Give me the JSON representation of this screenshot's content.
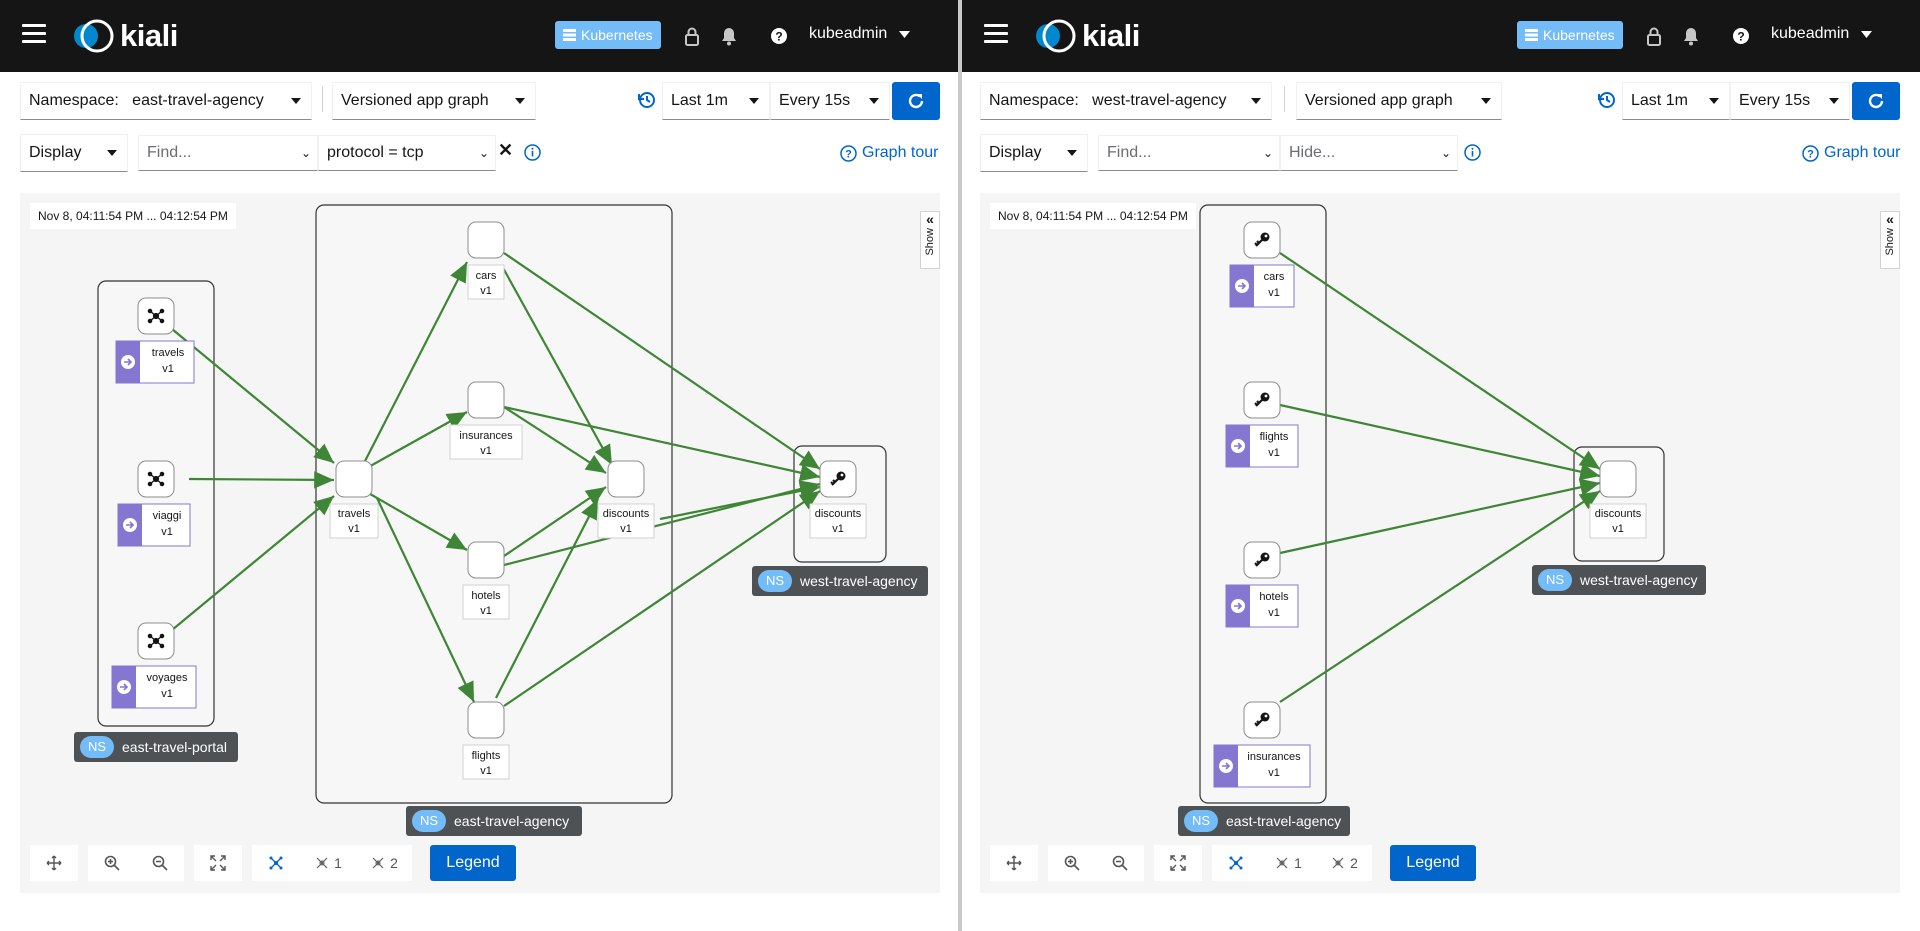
{
  "masthead": {
    "logo_text": "kiali",
    "cluster_badge": "Kubernetes",
    "user": "kubeadmin"
  },
  "panels": [
    {
      "namespace_label": "Namespace:",
      "namespace_value": "east-travel-agency",
      "graph_type": "Versioned app graph",
      "duration": "Last 1m",
      "refresh": "Every 15s",
      "display": "Display",
      "find_placeholder": "Find...",
      "filter_value": "protocol = tcp",
      "graph_tour": "Graph tour",
      "timestamp": "Nov 8, 04:11:54 PM ... 04:12:54 PM",
      "show_tab": "Show",
      "legend": "Legend",
      "namespace_boxes": [
        "east-travel-portal",
        "east-travel-agency",
        "west-travel-agency"
      ],
      "ns_badge": "NS",
      "nodes": [
        {
          "name": "travels",
          "version": "v1",
          "group": "east-travel-portal",
          "kind": "app"
        },
        {
          "name": "viaggi",
          "version": "v1",
          "group": "east-travel-portal",
          "kind": "app"
        },
        {
          "name": "voyages",
          "version": "v1",
          "group": "east-travel-portal",
          "kind": "app"
        },
        {
          "name": "travels",
          "version": "v1",
          "group": "east-travel-agency",
          "kind": "app"
        },
        {
          "name": "cars",
          "version": "v1",
          "group": "east-travel-agency",
          "kind": "app"
        },
        {
          "name": "insurances",
          "version": "v1",
          "group": "east-travel-agency",
          "kind": "app"
        },
        {
          "name": "hotels",
          "version": "v1",
          "group": "east-travel-agency",
          "kind": "app"
        },
        {
          "name": "flights",
          "version": "v1",
          "group": "east-travel-agency",
          "kind": "app"
        },
        {
          "name": "discounts",
          "version": "v1",
          "group": "east-travel-agency",
          "kind": "app"
        },
        {
          "name": "discounts",
          "version": "v1",
          "group": "west-travel-agency",
          "kind": "app"
        }
      ],
      "toolbar_counts": [
        "1",
        "2"
      ]
    },
    {
      "namespace_label": "Namespace:",
      "namespace_value": "west-travel-agency",
      "graph_type": "Versioned app graph",
      "duration": "Last 1m",
      "refresh": "Every 15s",
      "display": "Display",
      "find_placeholder": "Find...",
      "hide_placeholder": "Hide...",
      "graph_tour": "Graph tour",
      "timestamp": "Nov 8, 04:11:54 PM ... 04:12:54 PM",
      "show_tab": "Show",
      "legend": "Legend",
      "namespace_boxes": [
        "east-travel-agency",
        "west-travel-agency"
      ],
      "ns_badge": "NS",
      "nodes": [
        {
          "name": "cars",
          "version": "v1",
          "group": "east-travel-agency",
          "kind": "service-entry"
        },
        {
          "name": "flights",
          "version": "v1",
          "group": "east-travel-agency",
          "kind": "service-entry"
        },
        {
          "name": "hotels",
          "version": "v1",
          "group": "east-travel-agency",
          "kind": "service-entry"
        },
        {
          "name": "insurances",
          "version": "v1",
          "group": "east-travel-agency",
          "kind": "service-entry"
        },
        {
          "name": "discounts",
          "version": "v1",
          "group": "west-travel-agency",
          "kind": "app"
        }
      ],
      "toolbar_counts": [
        "1",
        "2"
      ]
    }
  ],
  "colors": {
    "masthead": "#151515",
    "edge": "#3e8635",
    "app_badge": "#8476d1",
    "primary": "#06c",
    "ns_badge": "#73bcf7"
  }
}
